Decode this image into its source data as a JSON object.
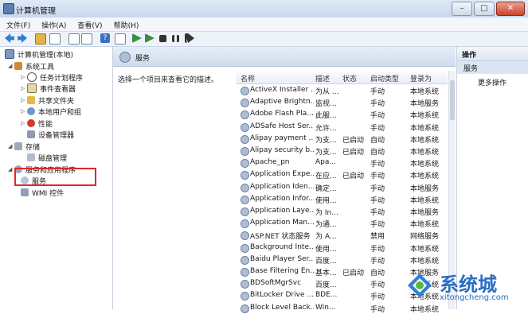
{
  "window": {
    "title": "计算机管理"
  },
  "menu": [
    "文件(F)",
    "操作(A)",
    "查看(V)",
    "帮助(H)"
  ],
  "tree": [
    {
      "label": "计算机管理(本地)",
      "icon": "computer-icon",
      "indent": 0
    },
    {
      "label": "系统工具",
      "icon": "tools-icon",
      "indent": 1
    },
    {
      "label": "任务计划程序",
      "icon": "clock-icon",
      "indent": 2
    },
    {
      "label": "事件查看器",
      "icon": "event-icon",
      "indent": 2
    },
    {
      "label": "共享文件夹",
      "icon": "share-icon",
      "indent": 2
    },
    {
      "label": "本地用户和组",
      "icon": "users-icon",
      "indent": 2
    },
    {
      "label": "性能",
      "icon": "perf-icon",
      "indent": 2
    },
    {
      "label": "设备管理器",
      "icon": "device-icon",
      "indent": 2
    },
    {
      "label": "存储",
      "icon": "storage-icon",
      "indent": 1
    },
    {
      "label": "磁盘管理",
      "icon": "disk-icon",
      "indent": 2
    },
    {
      "label": "服务和应用程序",
      "icon": "gear-icon",
      "indent": 1
    },
    {
      "label": "服务",
      "icon": "service-icon",
      "indent": 2
    },
    {
      "label": "WMI 控件",
      "icon": "wmi-icon",
      "indent": 2
    }
  ],
  "middle": {
    "title": "服务",
    "description": "选择一个项目来查看它的描述。",
    "columns": [
      "名称",
      "描述",
      "状态",
      "启动类型",
      "登录为"
    ],
    "rows": [
      [
        "ActiveX Installer ...",
        "为从 ...",
        "",
        "手动",
        "本地系统"
      ],
      [
        "Adaptive Brightn...",
        "监视...",
        "",
        "手动",
        "本地服务"
      ],
      [
        "Adobe Flash Pla...",
        "此服...",
        "",
        "手动",
        "本地系统"
      ],
      [
        "ADSafe Host Ser...",
        "允许...",
        "",
        "手动",
        "本地系统"
      ],
      [
        "Alipay payment ...",
        "为支...",
        "已启动",
        "自动",
        "本地系统"
      ],
      [
        "Alipay security b...",
        "为支...",
        "已启动",
        "自动",
        "本地系统"
      ],
      [
        "Apache_pn",
        "Apa...",
        "",
        "手动",
        "本地系统"
      ],
      [
        "Application Expe...",
        "在应...",
        "已启动",
        "手动",
        "本地系统"
      ],
      [
        "Application Iden...",
        "确定...",
        "",
        "手动",
        "本地服务"
      ],
      [
        "Application Infor...",
        "使用...",
        "",
        "手动",
        "本地系统"
      ],
      [
        "Application Laye...",
        "为 In...",
        "",
        "手动",
        "本地服务"
      ],
      [
        "Application Man...",
        "为通...",
        "",
        "手动",
        "本地系统"
      ],
      [
        "ASP.NET 状态服务",
        "为 A...",
        "",
        "禁用",
        "网络服务"
      ],
      [
        "Background Inte...",
        "使用...",
        "",
        "手动",
        "本地系统"
      ],
      [
        "Baidu Player Ser...",
        "百度...",
        "",
        "手动",
        "本地系统"
      ],
      [
        "Base Filtering En...",
        "基本...",
        "已启动",
        "自动",
        "本地服务"
      ],
      [
        "BDSoftMgrSvc",
        "百度...",
        "",
        "手动",
        "本地系统"
      ],
      [
        "BitLocker Drive ...",
        "BDE...",
        "",
        "手动",
        "本地系统"
      ],
      [
        "Block Level Back...",
        "Win...",
        "",
        "手动",
        "本地系统"
      ]
    ]
  },
  "actions": {
    "header": "操作",
    "group": "服务",
    "more": "更多操作"
  },
  "watermark": {
    "brand": "系统城",
    "url": "xitongcheng.com"
  }
}
